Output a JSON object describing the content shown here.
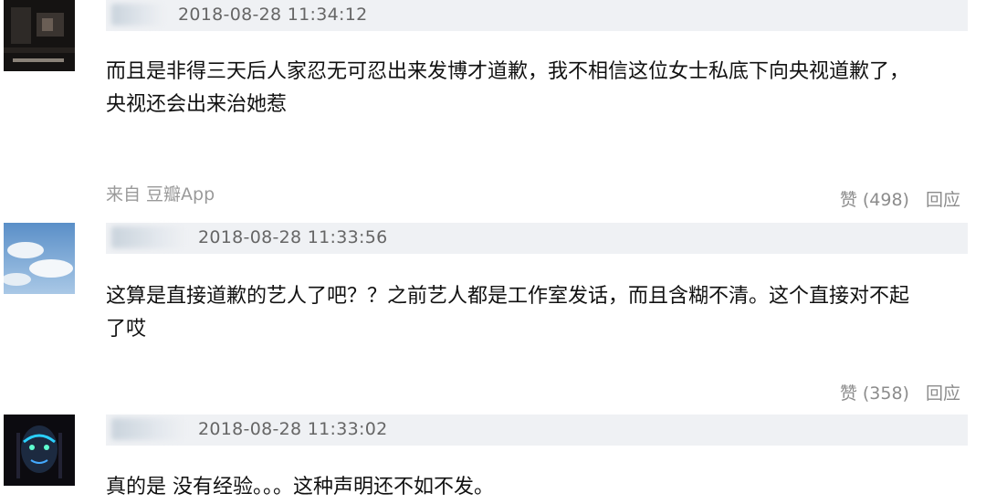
{
  "comments": [
    {
      "username": "",
      "timestamp": "2018-08-28 11:34:12",
      "content_lines": [
        "而且是非得三天后人家忍无可忍出来发博才道歉，我不相信这位女士私底下向央视道歉了，",
        "央视还会出来治她惹"
      ],
      "source": "来自 豆瓣App",
      "like_label": "赞 (498)",
      "reply_label": "回应"
    },
    {
      "username": "",
      "timestamp": "2018-08-28 11:33:56",
      "content_lines": [
        "这算是直接道歉的艺人了吧？？之前艺人都是工作室发话，而且含糊不清。这个直接对不起",
        "了哎"
      ],
      "like_label": "赞 (358)",
      "reply_label": "回应"
    },
    {
      "username": "",
      "timestamp": "2018-08-28 11:33:02",
      "content_lines": [
        "真的是 没有经验。。。这种声明还不如不发。"
      ]
    }
  ],
  "colors": {
    "header_bg": "#eff1f4",
    "meta_gray": "#8c8c8c",
    "text": "#111111"
  }
}
